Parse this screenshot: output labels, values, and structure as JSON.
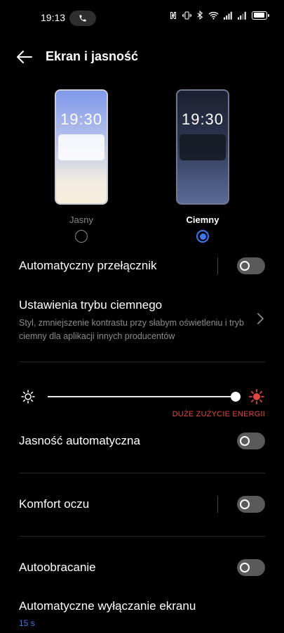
{
  "status_bar": {
    "time": "19:13",
    "icons": [
      "phone-call-icon",
      "nfc-icon",
      "vibrate-icon",
      "bluetooth-icon",
      "wifi-icon",
      "signal-icon",
      "signal-icon",
      "battery-icon"
    ],
    "battery_level": 0.9
  },
  "header": {
    "back_icon": "arrow-left-icon",
    "title": "Ekran i jasność"
  },
  "themes": {
    "light": {
      "label": "Jasny",
      "preview_time": "19:30",
      "selected": false
    },
    "dark": {
      "label": "Ciemny",
      "preview_time": "19:30",
      "selected": true
    },
    "accent_color": "#3d79f5"
  },
  "settings": {
    "auto_switch": {
      "label": "Automatyczny przełącznik",
      "enabled": false
    },
    "dark_mode_settings": {
      "label": "Ustawienia trybu ciemnego",
      "description": "Styl, zmniejszenie kontrastu przy słabym oświetleniu i tryb ciemny dla aplikacji innych producentów"
    },
    "brightness": {
      "level": 1.0,
      "warning": "DUŻE ZUŻYCIE ENERGII",
      "warning_color": "#e2463f"
    },
    "auto_brightness": {
      "label": "Jasność automatyczna",
      "enabled": false
    },
    "eye_comfort": {
      "label": "Komfort oczu",
      "enabled": false
    },
    "auto_rotate": {
      "label": "Autoobracanie",
      "enabled": false
    },
    "screen_timeout": {
      "label": "Automatyczne wyłączanie ekranu",
      "value": "15 s"
    }
  }
}
